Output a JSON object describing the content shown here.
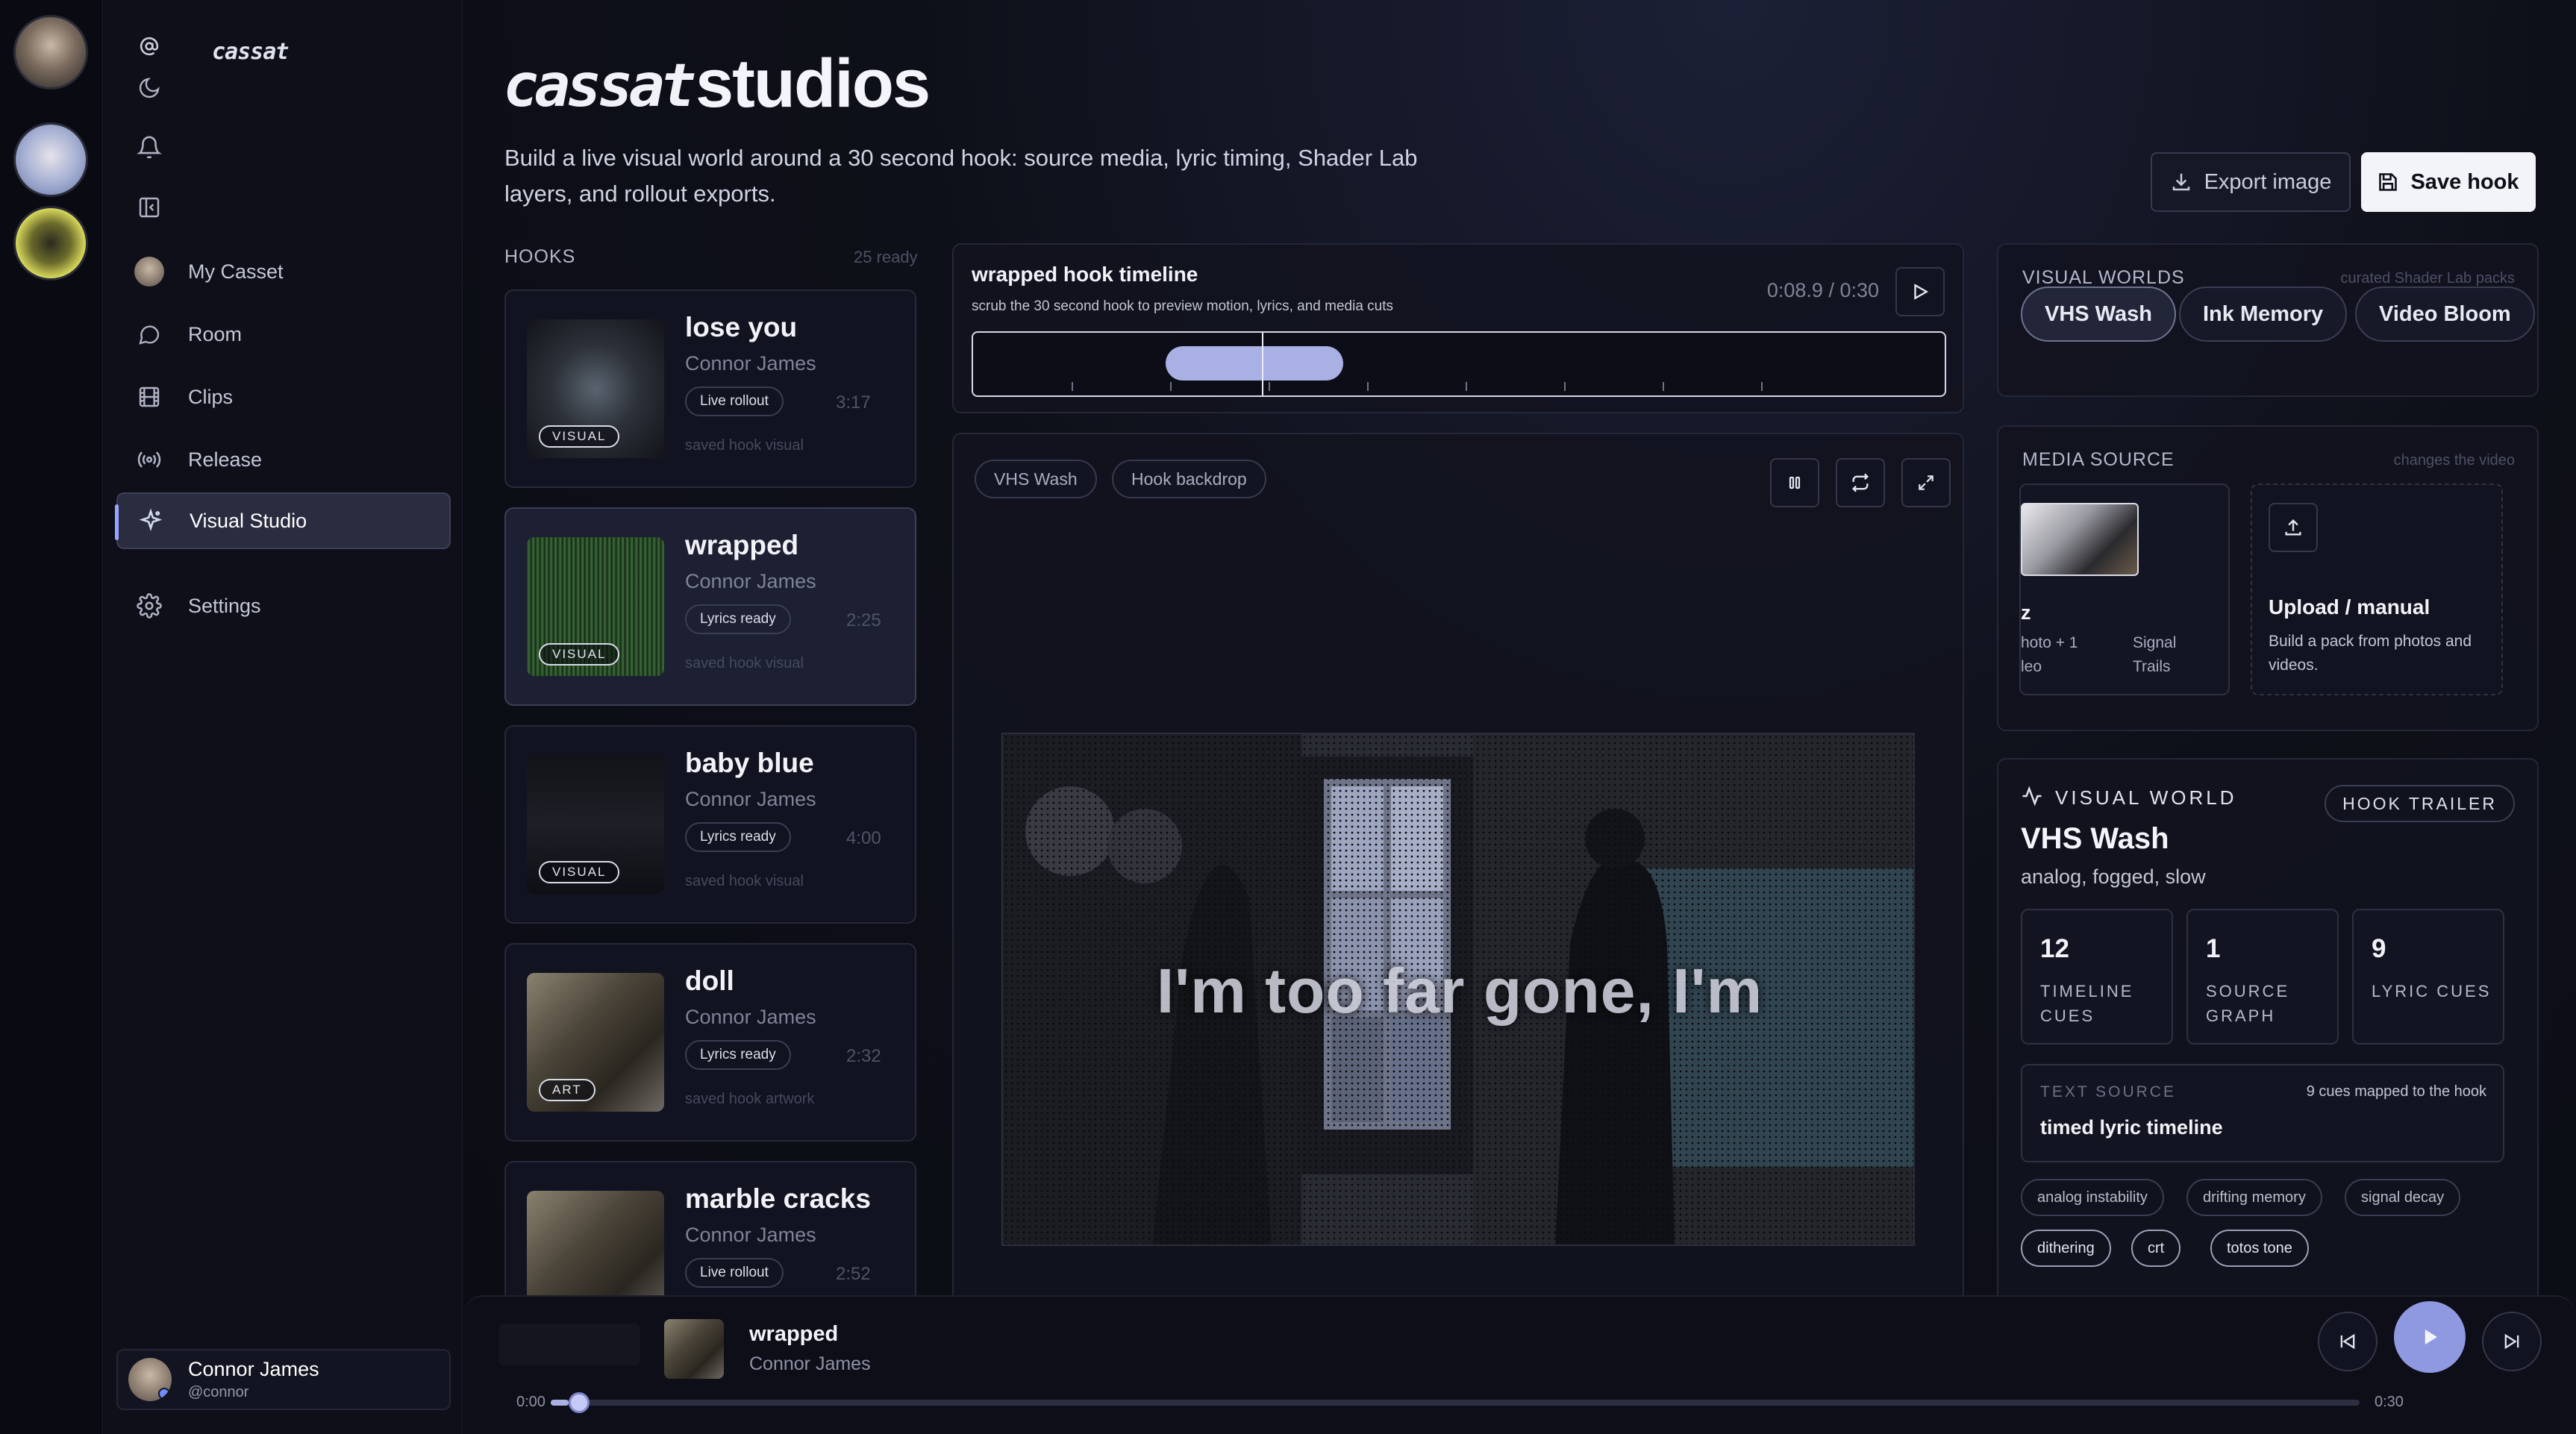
{
  "app": {
    "logo": "cassat"
  },
  "sidebar": {
    "items": [
      {
        "label": "My Casset",
        "icon": "avatar-icon"
      },
      {
        "label": "Room",
        "icon": "chat-bubble-icon"
      },
      {
        "label": "Clips",
        "icon": "film-icon"
      },
      {
        "label": "Release",
        "icon": "broadcast-icon"
      },
      {
        "label": "Visual Studio",
        "icon": "sparkle-icon",
        "active": true
      },
      {
        "label": "Settings",
        "icon": "gear-icon"
      }
    ],
    "profile": {
      "name": "Connor James",
      "handle": "@connor"
    }
  },
  "header": {
    "brand": "cassat",
    "title": "studios",
    "subtitle": "Build a live visual world around a 30 second hook: source media, lyric timing, Shader Lab layers, and rollout exports.",
    "export_label": "Export image",
    "save_label": "Save hook"
  },
  "hooks": {
    "label": "HOOKS",
    "count": "25 ready",
    "items": [
      {
        "title": "lose you",
        "artist": "Connor James",
        "status": "Live rollout",
        "duration": "3:17",
        "badge": "VISUAL",
        "saved": "saved hook visual"
      },
      {
        "title": "wrapped",
        "artist": "Connor James",
        "status": "Lyrics ready",
        "duration": "2:25",
        "badge": "VISUAL",
        "saved": "saved hook visual"
      },
      {
        "title": "baby blue",
        "artist": "Connor James",
        "status": "Lyrics ready",
        "duration": "4:00",
        "badge": "VISUAL",
        "saved": "saved hook visual"
      },
      {
        "title": "doll",
        "artist": "Connor James",
        "status": "Lyrics ready",
        "duration": "2:32",
        "badge": "ART",
        "saved": "saved hook artwork"
      },
      {
        "title": "marble cracks",
        "artist": "Connor James",
        "status": "Live rollout",
        "duration": "2:52"
      }
    ]
  },
  "timeline": {
    "title": "wrapped hook timeline",
    "subtitle": "scrub the 30 second hook to preview motion, lyrics, and media cuts",
    "time": "0:08.9 / 0:30",
    "progress": 0.297
  },
  "stage": {
    "chips": [
      "VHS Wash",
      "Hook backdrop"
    ],
    "lyric": "I'm too far gone, I'm"
  },
  "visual_worlds": {
    "label": "VISUAL WORLDS",
    "aside": "curated Shader Lab packs",
    "options": [
      "VHS Wash",
      "Ink Memory",
      "Video Bloom"
    ],
    "selected": "VHS Wash"
  },
  "media_source": {
    "label": "MEDIA SOURCE",
    "aside": "changes the video",
    "card": {
      "title": "z",
      "left_line1": "hoto + 1",
      "left_line2": "leo",
      "right_line1": "Signal",
      "right_line2": "Trails"
    },
    "upload": {
      "title": "Upload / manual",
      "desc": "Build a pack from photos and videos."
    }
  },
  "world_detail": {
    "label": "VISUAL WORLD",
    "badge": "HOOK TRAILER",
    "name": "VHS Wash",
    "desc": "analog, fogged, slow",
    "stats": [
      {
        "value": "12",
        "label": "TIMELINE CUES"
      },
      {
        "value": "1",
        "label": "SOURCE GRAPH"
      },
      {
        "value": "9",
        "label": "LYRIC CUES"
      }
    ],
    "text_source": {
      "label": "TEXT SOURCE",
      "aside": "9 cues mapped to the hook",
      "value": "timed lyric timeline"
    },
    "tags": [
      "analog instability",
      "drifting memory",
      "signal decay",
      "dithering",
      "crt",
      "totos tone"
    ]
  },
  "player": {
    "title": "wrapped",
    "artist": "Connor James",
    "time_start": "0:00",
    "time_end": "0:30",
    "progress": 0.01
  },
  "colors": {
    "accent": "#a9b0e3",
    "background": "#0b0c14"
  }
}
